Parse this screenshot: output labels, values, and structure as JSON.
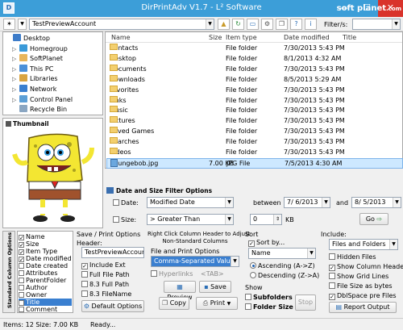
{
  "window": {
    "title": "DirPrintAdv  V1.7  -  L² Software",
    "min": "—",
    "max": "☐",
    "close": "✕",
    "logo_char": "D"
  },
  "toolbar": {
    "path": "TestPreviewAccount",
    "filter_label": "Filter/s:",
    "icons": [
      "star-add-icon",
      "dropdown-icon",
      "folder-up-icon",
      "refresh-icon",
      "monitor-icon",
      "settings-icon",
      "copy-icon",
      "help-icon",
      "info-icon"
    ]
  },
  "tree": [
    {
      "label": "Desktop",
      "icon": "desktop-icon",
      "color": "#3d7cc9",
      "indent": 0,
      "expander": ""
    },
    {
      "label": "Homegroup",
      "icon": "homegroup-icon",
      "color": "#3a9ad9",
      "indent": 1,
      "expander": "▷"
    },
    {
      "label": "SoftPlanet",
      "icon": "user-icon",
      "color": "#e8b55a",
      "indent": 1,
      "expander": "▷"
    },
    {
      "label": "This PC",
      "icon": "computer-icon",
      "color": "#4a90d9",
      "indent": 1,
      "expander": "▷"
    },
    {
      "label": "Libraries",
      "icon": "library-icon",
      "color": "#d9a441",
      "indent": 1,
      "expander": "▷"
    },
    {
      "label": "Network",
      "icon": "network-icon",
      "color": "#3a7fcf",
      "indent": 1,
      "expander": "▷"
    },
    {
      "label": "Control Panel",
      "icon": "control-panel-icon",
      "color": "#5c9fd6",
      "indent": 1,
      "expander": "▷"
    },
    {
      "label": "Recycle Bin",
      "icon": "recycle-bin-icon",
      "color": "#8aa6c2",
      "indent": 1,
      "expander": ""
    }
  ],
  "thumbnail": {
    "label": "Thumbnail"
  },
  "files": {
    "headers": {
      "name": "Name",
      "size": "Size",
      "type": "Item type",
      "date": "Date modified",
      "title": "Title"
    },
    "rows": [
      {
        "name": "Contacts",
        "size": "",
        "type": "File folder",
        "date": "7/30/2013 5:43 PM",
        "title": ""
      },
      {
        "name": "Desktop",
        "size": "",
        "type": "File folder",
        "date": "8/1/2013 4:32 AM",
        "title": ""
      },
      {
        "name": "Documents",
        "size": "",
        "type": "File folder",
        "date": "7/30/2013 5:43 PM",
        "title": ""
      },
      {
        "name": "Downloads",
        "size": "",
        "type": "File folder",
        "date": "8/5/2013 5:29 AM",
        "title": ""
      },
      {
        "name": "Favorites",
        "size": "",
        "type": "File folder",
        "date": "7/30/2013 5:43 PM",
        "title": ""
      },
      {
        "name": "Links",
        "size": "",
        "type": "File folder",
        "date": "7/30/2013 5:43 PM",
        "title": ""
      },
      {
        "name": "Music",
        "size": "",
        "type": "File folder",
        "date": "7/30/2013 5:43 PM",
        "title": ""
      },
      {
        "name": "Pictures",
        "size": "",
        "type": "File folder",
        "date": "7/30/2013 5:43 PM",
        "title": ""
      },
      {
        "name": "Saved Games",
        "size": "",
        "type": "File folder",
        "date": "7/30/2013 5:43 PM",
        "title": ""
      },
      {
        "name": "Searches",
        "size": "",
        "type": "File folder",
        "date": "7/30/2013 5:43 PM",
        "title": ""
      },
      {
        "name": "Videos",
        "size": "",
        "type": "File folder",
        "date": "7/30/2013 5:43 PM",
        "title": ""
      },
      {
        "name": "spungebob.jpg",
        "size": "7.00 KB",
        "type": "JPG File",
        "date": "7/5/2013 4:30 AM",
        "title": "",
        "selected": true
      }
    ]
  },
  "filter": {
    "title": "Date and Size Filter Options",
    "date_label": "Date:",
    "date_mode": "Modified Date",
    "between": "between",
    "and": "and",
    "date_from": "7/  6/2013",
    "date_to": "8/  5/2013",
    "size_label": "Size:",
    "size_mode": "> Greater Than",
    "size_value": "0",
    "size_unit": "KB",
    "go": "Go"
  },
  "columns": {
    "side_label": "Standard Column Options",
    "items": [
      {
        "label": "Name",
        "checked": true
      },
      {
        "label": "Size",
        "checked": true
      },
      {
        "label": "Item Type",
        "checked": true
      },
      {
        "label": "Date modified",
        "checked": true
      },
      {
        "label": "Date created",
        "checked": false
      },
      {
        "label": "Attributes",
        "checked": false
      },
      {
        "label": "ParentFolder",
        "checked": false
      },
      {
        "label": "Author",
        "checked": false
      },
      {
        "label": "Owner",
        "checked": false
      },
      {
        "label": "Title",
        "checked": true,
        "selected": true
      },
      {
        "label": "Comment",
        "checked": false
      }
    ]
  },
  "save": {
    "title": "Save / Print Options",
    "header_label": "Header:",
    "header_value": "TestPreviewAccount",
    "include_ext": "Include Ext",
    "full_file_path": "Full File Path",
    "short_full_path": "8.3 Full Path",
    "short_file_name": "8.3 FileName",
    "default_options": "Default Options"
  },
  "nonstd": {
    "title1": "Right Click Column Header to Adjust",
    "title2": "Non-Standard Columns",
    "fp_label": "File and Print Options",
    "format": "Comma-Separated Values",
    "hyperlinks": "Hyperlinks",
    "tab": "<TAB>",
    "preview": "Preview",
    "save": "Save",
    "copy": "Copy",
    "print": "Print"
  },
  "sort": {
    "title": "Sort",
    "sort_by": "Sort by...",
    "field": "Name",
    "asc": "Ascending (A->Z)",
    "desc": "Descending (Z->A)"
  },
  "show": {
    "title": "Show",
    "subfolders": "Subfolders",
    "folder_size": "Folder Size",
    "stop": "Stop"
  },
  "include": {
    "title": "Include:",
    "mode": "Files and Folders",
    "hidden": "Hidden Files",
    "show_col_headers": "Show Column Headers",
    "grid": "Show Grid Lines",
    "size_bytes": "File Size as bytes",
    "dbl_space": "DblSpace pre Files",
    "report": "Report Output"
  },
  "status": {
    "items": "Items: 12  Size: 7.00 KB",
    "state": "Ready..."
  },
  "watermark": {
    "text": "soft planet",
    "suffix": ".com"
  }
}
